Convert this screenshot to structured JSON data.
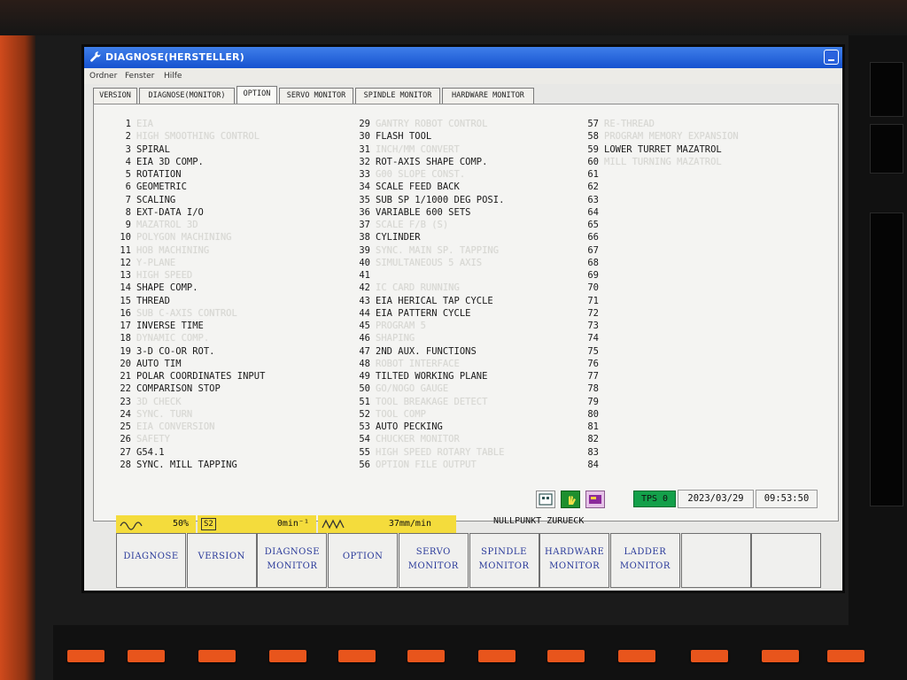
{
  "window": {
    "title": "DIAGNOSE(HERSTELLER)",
    "icon": "wrench-icon",
    "accent_color": "#1f5fdc"
  },
  "menu": [
    "Ordner",
    "Fenster",
    "Hilfe"
  ],
  "tabs": [
    {
      "label": "VERSION",
      "active": false
    },
    {
      "label": "DIAGNOSE(MONITOR)",
      "active": false
    },
    {
      "label": "OPTION",
      "active": true
    },
    {
      "label": "SERVO MONITOR",
      "active": false
    },
    {
      "label": "SPINDLE MONITOR",
      "active": false
    },
    {
      "label": "HARDWARE MONITOR",
      "active": false
    }
  ],
  "options": {
    "col1": [
      {
        "no": "1",
        "name": "EIA",
        "enabled": false
      },
      {
        "no": "2",
        "name": "HIGH SMOOTHING CONTROL",
        "enabled": false
      },
      {
        "no": "3",
        "name": "SPIRAL",
        "enabled": true
      },
      {
        "no": "4",
        "name": "EIA 3D COMP.",
        "enabled": true
      },
      {
        "no": "5",
        "name": "ROTATION",
        "enabled": true
      },
      {
        "no": "6",
        "name": "GEOMETRIC",
        "enabled": true
      },
      {
        "no": "7",
        "name": "SCALING",
        "enabled": true
      },
      {
        "no": "8",
        "name": "EXT-DATA I/O",
        "enabled": true
      },
      {
        "no": "9",
        "name": "MAZATROL 3D",
        "enabled": false
      },
      {
        "no": "10",
        "name": "POLYGON MACHINING",
        "enabled": false
      },
      {
        "no": "11",
        "name": "HOB MACHINING",
        "enabled": false
      },
      {
        "no": "12",
        "name": "Y-PLANE",
        "enabled": false
      },
      {
        "no": "13",
        "name": "HIGH SPEED",
        "enabled": false
      },
      {
        "no": "14",
        "name": "SHAPE COMP.",
        "enabled": true
      },
      {
        "no": "15",
        "name": "THREAD",
        "enabled": true
      },
      {
        "no": "16",
        "name": "SUB C-AXIS CONTROL",
        "enabled": false
      },
      {
        "no": "17",
        "name": "INVERSE TIME",
        "enabled": true
      },
      {
        "no": "18",
        "name": "DYNAMIC COMP.",
        "enabled": false
      },
      {
        "no": "19",
        "name": "3-D CO-OR ROT.",
        "enabled": true
      },
      {
        "no": "20",
        "name": "AUTO TIM",
        "enabled": true
      },
      {
        "no": "21",
        "name": "POLAR COORDINATES INPUT",
        "enabled": true
      },
      {
        "no": "22",
        "name": "COMPARISON STOP",
        "enabled": true
      },
      {
        "no": "23",
        "name": "3D CHECK",
        "enabled": false
      },
      {
        "no": "24",
        "name": "SYNC. TURN",
        "enabled": false
      },
      {
        "no": "25",
        "name": "EIA CONVERSION",
        "enabled": false
      },
      {
        "no": "26",
        "name": "SAFETY",
        "enabled": false
      },
      {
        "no": "27",
        "name": "G54.1",
        "enabled": true
      },
      {
        "no": "28",
        "name": "SYNC. MILL TAPPING",
        "enabled": true
      }
    ],
    "col2": [
      {
        "no": "29",
        "name": "GANTRY ROBOT CONTROL",
        "enabled": false
      },
      {
        "no": "30",
        "name": "FLASH TOOL",
        "enabled": true
      },
      {
        "no": "31",
        "name": "INCH/MM CONVERT",
        "enabled": false
      },
      {
        "no": "32",
        "name": "ROT-AXIS SHAPE COMP.",
        "enabled": true
      },
      {
        "no": "33",
        "name": "G00 SLOPE CONST.",
        "enabled": false
      },
      {
        "no": "34",
        "name": "SCALE FEED BACK",
        "enabled": true
      },
      {
        "no": "35",
        "name": "SUB SP 1/1000 DEG POSI.",
        "enabled": true
      },
      {
        "no": "36",
        "name": "VARIABLE 600 SETS",
        "enabled": true
      },
      {
        "no": "37",
        "name": "SCALE F/B (S)",
        "enabled": false
      },
      {
        "no": "38",
        "name": "CYLINDER",
        "enabled": true
      },
      {
        "no": "39",
        "name": "SYNC. MAIN SP. TAPPING",
        "enabled": false
      },
      {
        "no": "40",
        "name": "SIMULTANEOUS 5 AXIS",
        "enabled": false
      },
      {
        "no": "41",
        "name": "",
        "enabled": false
      },
      {
        "no": "42",
        "name": "IC CARD RUNNING",
        "enabled": false
      },
      {
        "no": "43",
        "name": "EIA HERICAL TAP CYCLE",
        "enabled": true
      },
      {
        "no": "44",
        "name": "EIA PATTERN CYCLE",
        "enabled": true
      },
      {
        "no": "45",
        "name": "PROGRAM 5",
        "enabled": false
      },
      {
        "no": "46",
        "name": "SHAPING",
        "enabled": false
      },
      {
        "no": "47",
        "name": "2ND AUX. FUNCTIONS",
        "enabled": true
      },
      {
        "no": "48",
        "name": "ROBOT INTERFACE",
        "enabled": false
      },
      {
        "no": "49",
        "name": "TILTED WORKING PLANE",
        "enabled": true
      },
      {
        "no": "50",
        "name": "GO/NOGO GAUGE",
        "enabled": false
      },
      {
        "no": "51",
        "name": "TOOL BREAKAGE DETECT",
        "enabled": false
      },
      {
        "no": "52",
        "name": "TOOL COMP",
        "enabled": false
      },
      {
        "no": "53",
        "name": "AUTO PECKING",
        "enabled": true
      },
      {
        "no": "54",
        "name": "CHUCKER MONITOR",
        "enabled": false
      },
      {
        "no": "55",
        "name": "HIGH SPEED ROTARY TABLE",
        "enabled": false
      },
      {
        "no": "56",
        "name": "OPTION FILE OUTPUT",
        "enabled": false
      }
    ],
    "col3": [
      {
        "no": "57",
        "name": "RE-THREAD",
        "enabled": false
      },
      {
        "no": "58",
        "name": "PROGRAM MEMORY EXPANSION",
        "enabled": false
      },
      {
        "no": "59",
        "name": "LOWER TURRET MAZATROL",
        "enabled": true
      },
      {
        "no": "60",
        "name": "MILL TURNING MAZATROL",
        "enabled": false
      },
      {
        "no": "61",
        "name": "",
        "enabled": false
      },
      {
        "no": "62",
        "name": "",
        "enabled": false
      },
      {
        "no": "63",
        "name": "",
        "enabled": false
      },
      {
        "no": "64",
        "name": "",
        "enabled": false
      },
      {
        "no": "65",
        "name": "",
        "enabled": false
      },
      {
        "no": "66",
        "name": "",
        "enabled": false
      },
      {
        "no": "67",
        "name": "",
        "enabled": false
      },
      {
        "no": "68",
        "name": "",
        "enabled": false
      },
      {
        "no": "69",
        "name": "",
        "enabled": false
      },
      {
        "no": "70",
        "name": "",
        "enabled": false
      },
      {
        "no": "71",
        "name": "",
        "enabled": false
      },
      {
        "no": "72",
        "name": "",
        "enabled": false
      },
      {
        "no": "73",
        "name": "",
        "enabled": false
      },
      {
        "no": "74",
        "name": "",
        "enabled": false
      },
      {
        "no": "75",
        "name": "",
        "enabled": false
      },
      {
        "no": "76",
        "name": "",
        "enabled": false
      },
      {
        "no": "77",
        "name": "",
        "enabled": false
      },
      {
        "no": "78",
        "name": "",
        "enabled": false
      },
      {
        "no": "79",
        "name": "",
        "enabled": false
      },
      {
        "no": "80",
        "name": "",
        "enabled": false
      },
      {
        "no": "81",
        "name": "",
        "enabled": false
      },
      {
        "no": "82",
        "name": "",
        "enabled": false
      },
      {
        "no": "83",
        "name": "",
        "enabled": false
      },
      {
        "no": "84",
        "name": "",
        "enabled": false
      }
    ],
    "enabled_color": "#1a1a1a",
    "disabled_color": "#d7d7d3"
  },
  "status": {
    "tps_label": "TPS",
    "tps_value": "0",
    "tps_color": "#13a04a",
    "date": "2023/03/29",
    "time": "09:53:50",
    "icons": [
      "keyboard-icon",
      "hand-icon",
      "card-icon"
    ]
  },
  "indicators": {
    "override": "50%",
    "spindle_label": "S2",
    "spindle": "0min⁻¹",
    "feed": "37mm/min",
    "message": "NULLPUNKT ZURUECK",
    "color": "#f4dc3c"
  },
  "softkeys": [
    {
      "l1": "DIAGNOSE",
      "l2": ""
    },
    {
      "l1": "VERSION",
      "l2": ""
    },
    {
      "l1": "DIAGNOSE",
      "l2": "MONITOR"
    },
    {
      "l1": "OPTION",
      "l2": ""
    },
    {
      "l1": "SERVO",
      "l2": "MONITOR"
    },
    {
      "l1": "SPINDLE",
      "l2": "MONITOR"
    },
    {
      "l1": "HARDWARE",
      "l2": "MONITOR"
    },
    {
      "l1": "LADDER",
      "l2": "MONITOR"
    },
    {
      "l1": "",
      "l2": ""
    },
    {
      "l1": "",
      "l2": ""
    }
  ]
}
